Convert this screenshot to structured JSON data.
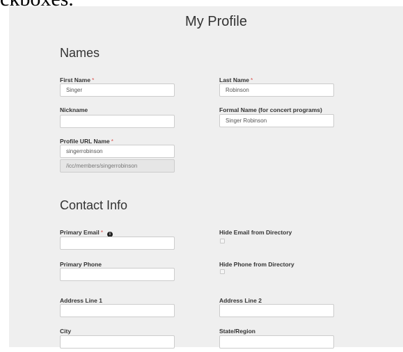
{
  "page": {
    "top_text": "ckboxes.",
    "title": "My Profile"
  },
  "names": {
    "heading": "Names",
    "first_name": {
      "label": "First Name",
      "value": "Singer"
    },
    "last_name": {
      "label": "Last Name",
      "value": "Robinson"
    },
    "nickname": {
      "label": "Nickname",
      "value": ""
    },
    "formal_name": {
      "label": "Formal Name (for concert programs)",
      "value": "Singer Robinson"
    },
    "profile_url": {
      "label": "Profile URL Name",
      "value": "singerrobinson",
      "preview": "/icc/members/singerrobinson"
    },
    "required_marker": "*"
  },
  "contact": {
    "heading": "Contact Info",
    "primary_email": {
      "label": "Primary Email",
      "value": ""
    },
    "hide_email": {
      "label": "Hide Email from Directory",
      "checked": false
    },
    "primary_phone": {
      "label": "Primary Phone",
      "value": ""
    },
    "hide_phone": {
      "label": "Hide Phone from Directory",
      "checked": false
    },
    "address1": {
      "label": "Address Line 1",
      "value": ""
    },
    "address2": {
      "label": "Address Line 2",
      "value": ""
    },
    "city": {
      "label": "City",
      "value": ""
    },
    "state": {
      "label": "State/Region",
      "value": ""
    }
  }
}
